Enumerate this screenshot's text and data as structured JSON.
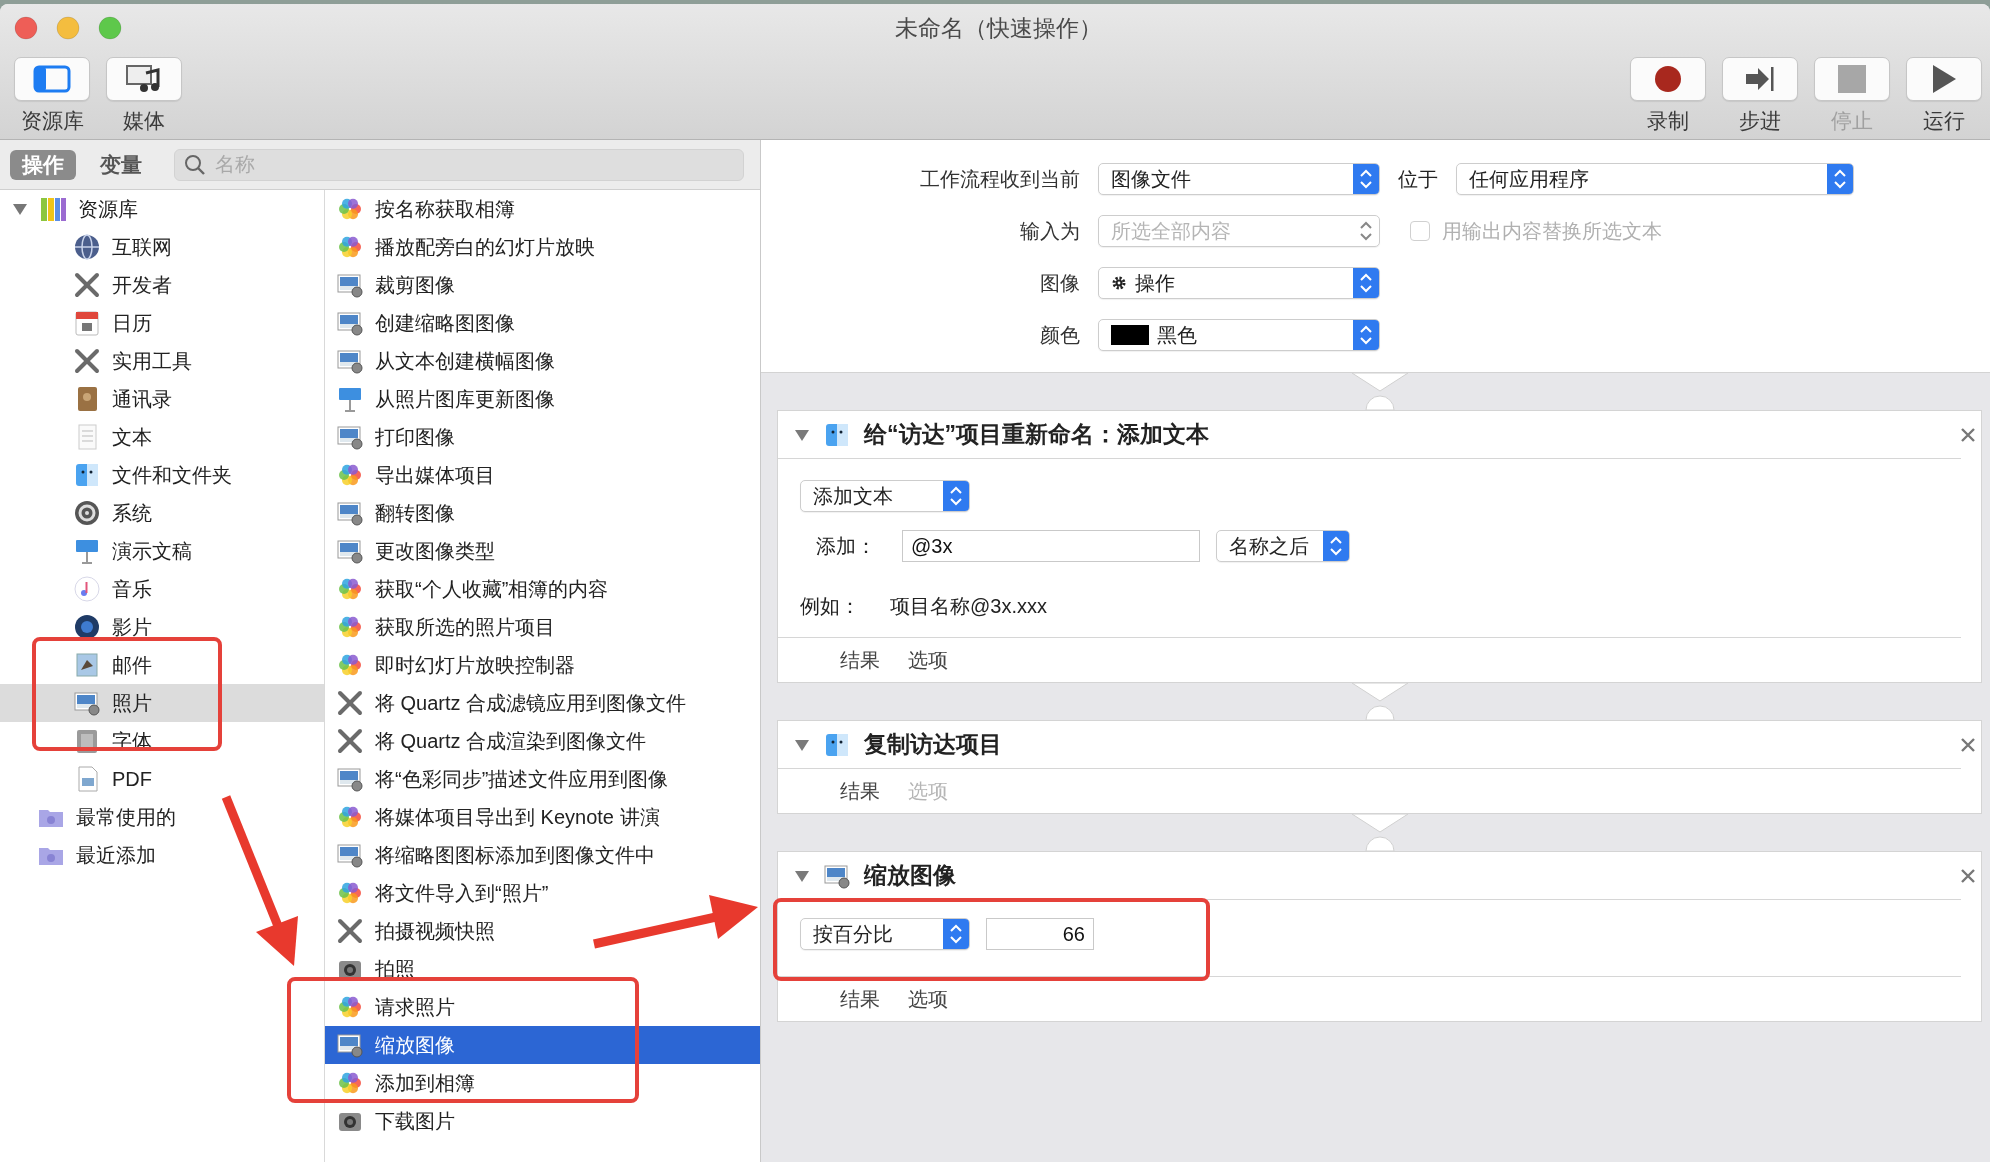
{
  "window": {
    "title": "未命名（快速操作）"
  },
  "toolbar": {
    "left": [
      {
        "label": "资源库",
        "kind": "library",
        "disabled": false
      },
      {
        "label": "媒体",
        "kind": "media",
        "disabled": false
      }
    ],
    "right": [
      {
        "label": "录制",
        "kind": "record",
        "disabled": false
      },
      {
        "label": "步进",
        "kind": "step",
        "disabled": false
      },
      {
        "label": "停止",
        "kind": "stop",
        "disabled": true
      },
      {
        "label": "运行",
        "kind": "run",
        "disabled": false
      }
    ]
  },
  "filter": {
    "segments": [
      {
        "label": "操作",
        "selected": true
      },
      {
        "label": "变量",
        "selected": false
      }
    ],
    "search": {
      "placeholder": "名称"
    }
  },
  "library": [
    {
      "label": "资源库",
      "kind": "library",
      "selected": false,
      "expanded": true,
      "children": [
        {
          "label": "互联网",
          "kind": "globe",
          "selected": false
        },
        {
          "label": "开发者",
          "kind": "tools",
          "selected": false
        },
        {
          "label": "日历",
          "kind": "calendar",
          "selected": false
        },
        {
          "label": "实用工具",
          "kind": "tools",
          "selected": false
        },
        {
          "label": "通讯录",
          "kind": "contacts",
          "selected": false
        },
        {
          "label": "文本",
          "kind": "text",
          "selected": false
        },
        {
          "label": "文件和文件夹",
          "kind": "finder",
          "selected": false
        },
        {
          "label": "系统",
          "kind": "system",
          "selected": false
        },
        {
          "label": "演示文稿",
          "kind": "keynote",
          "selected": false
        },
        {
          "label": "音乐",
          "kind": "music",
          "selected": false
        },
        {
          "label": "影片",
          "kind": "movie",
          "selected": false
        },
        {
          "label": "邮件",
          "kind": "mail",
          "selected": false
        },
        {
          "label": "照片",
          "kind": "image",
          "selected": true
        },
        {
          "label": "字体",
          "kind": "font",
          "selected": false
        },
        {
          "label": "PDF",
          "kind": "pdf",
          "selected": false
        }
      ]
    },
    {
      "label": "最常使用的",
      "kind": "folder",
      "selected": false
    },
    {
      "label": "最近添加",
      "kind": "folder",
      "selected": false
    }
  ],
  "actions": [
    {
      "label": "按名称获取相簿",
      "kind": "photos",
      "selected": false
    },
    {
      "label": "播放配旁白的幻灯片放映",
      "kind": "photos",
      "selected": false
    },
    {
      "label": "裁剪图像",
      "kind": "image",
      "selected": false
    },
    {
      "label": "创建缩略图图像",
      "kind": "image",
      "selected": false
    },
    {
      "label": "从文本创建横幅图像",
      "kind": "image",
      "selected": false
    },
    {
      "label": "从照片图库更新图像",
      "kind": "keynote",
      "selected": false
    },
    {
      "label": "打印图像",
      "kind": "image",
      "selected": false
    },
    {
      "label": "导出媒体项目",
      "kind": "photos",
      "selected": false
    },
    {
      "label": "翻转图像",
      "kind": "image",
      "selected": false
    },
    {
      "label": "更改图像类型",
      "kind": "image",
      "selected": false
    },
    {
      "label": "获取“个人收藏”相簿的内容",
      "kind": "photos",
      "selected": false
    },
    {
      "label": "获取所选的照片项目",
      "kind": "photos",
      "selected": false
    },
    {
      "label": "即时幻灯片放映控制器",
      "kind": "photos",
      "selected": false
    },
    {
      "label": "将 Quartz 合成滤镜应用到图像文件",
      "kind": "tools",
      "selected": false
    },
    {
      "label": "将 Quartz 合成渲染到图像文件",
      "kind": "tools",
      "selected": false
    },
    {
      "label": "将“色彩同步”描述文件应用到图像",
      "kind": "image",
      "selected": false
    },
    {
      "label": "将媒体项目导出到 Keynote 讲演",
      "kind": "photos",
      "selected": false
    },
    {
      "label": "将缩略图图标添加到图像文件中",
      "kind": "image",
      "selected": false
    },
    {
      "label": "将文件导入到“照片”",
      "kind": "photos",
      "selected": false
    },
    {
      "label": "拍摄视频快照",
      "kind": "tools",
      "selected": false
    },
    {
      "label": "拍照",
      "kind": "camera",
      "selected": false
    },
    {
      "label": "请求照片",
      "kind": "photos",
      "selected": false
    },
    {
      "label": "缩放图像",
      "kind": "image",
      "selected": true
    },
    {
      "label": "添加到相簿",
      "kind": "photos",
      "selected": false
    },
    {
      "label": "下载图片",
      "kind": "camera",
      "selected": false
    }
  ],
  "workflow_settings": {
    "receives": {
      "label": "工作流程收到当前",
      "value": "图像文件"
    },
    "location": {
      "label": "位于",
      "value": "任何应用程序"
    },
    "input": {
      "label": "输入为",
      "value": "所选全部内容",
      "disabled": true
    },
    "replace": {
      "label": "用输出内容替换所选文本",
      "checked": false,
      "disabled": true
    },
    "image": {
      "label": "图像",
      "value": "操作"
    },
    "color": {
      "label": "颜色",
      "value": "黑色",
      "color": "#000000"
    }
  },
  "workflow": [
    {
      "kind": "rename",
      "title": "给“访达”项目重新命名：添加文本",
      "expanded": true,
      "mode": "添加文本",
      "add_label": "添加：",
      "add_value": "@3x",
      "position": "名称之后",
      "example_label": "例如：",
      "example_value": "项目名称@3x.xxx",
      "tabs": [
        {
          "label": "结果",
          "disabled": false
        },
        {
          "label": "选项",
          "disabled": false
        }
      ]
    },
    {
      "kind": "copy",
      "title": "复制访达项目",
      "expanded": true,
      "tabs": [
        {
          "label": "结果",
          "disabled": false
        },
        {
          "label": "选项",
          "disabled": true
        }
      ]
    },
    {
      "kind": "scale",
      "title": "缩放图像",
      "expanded": true,
      "mode": "按百分比",
      "value": "66",
      "tabs": [
        {
          "label": "结果",
          "disabled": false
        },
        {
          "label": "选项",
          "disabled": false
        }
      ]
    }
  ]
}
